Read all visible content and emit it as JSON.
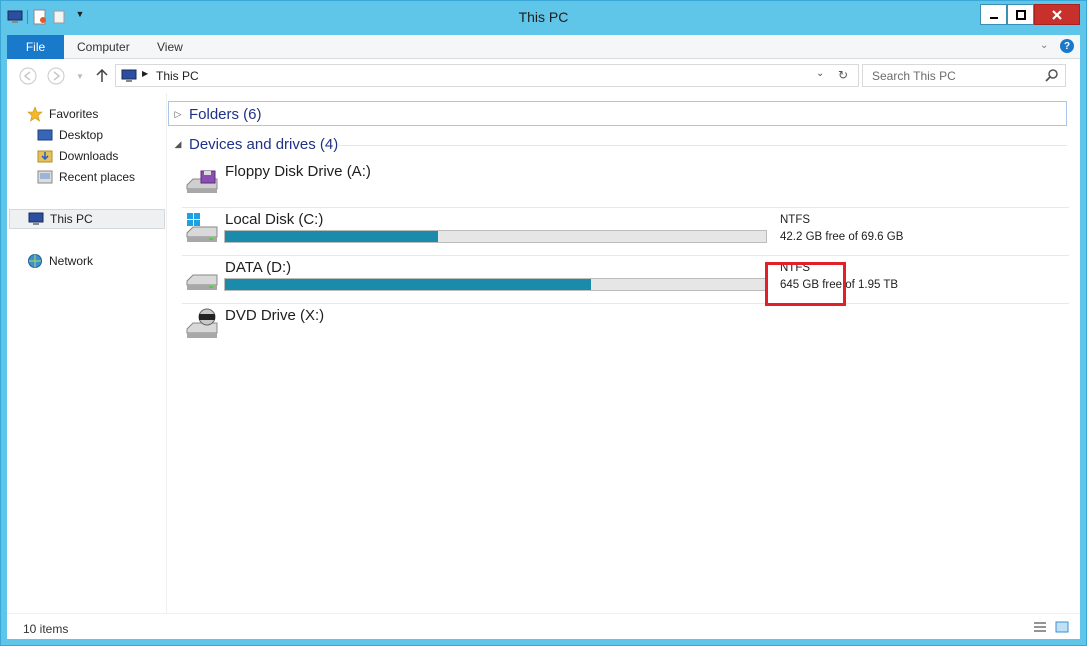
{
  "window": {
    "title": "This PC"
  },
  "ribbon": {
    "tabs": [
      "File",
      "Computer",
      "View"
    ]
  },
  "address": {
    "path": "This PC"
  },
  "search": {
    "placeholder": "Search This PC"
  },
  "sidebar": {
    "items": [
      {
        "label": "Favorites",
        "icon": "star-icon"
      },
      {
        "label": "Desktop",
        "icon": "desktop-icon"
      },
      {
        "label": "Downloads",
        "icon": "downloads-icon"
      },
      {
        "label": "Recent places",
        "icon": "recent-places-icon"
      },
      {
        "label": "This PC",
        "icon": "computer-icon"
      },
      {
        "label": "Network",
        "icon": "network-icon"
      }
    ]
  },
  "groups": {
    "folders": {
      "label": "Folders (6)"
    },
    "devices": {
      "label": "Devices and drives (4)"
    }
  },
  "drives": [
    {
      "name": "Floppy Disk Drive (A:)",
      "fs": "",
      "free": "",
      "used_fraction": null
    },
    {
      "name": "Local Disk (C:)",
      "fs": "NTFS",
      "free": "42.2 GB free of 69.6 GB",
      "used_fraction": 0.394
    },
    {
      "name": "DATA (D:)",
      "fs": "NTFS",
      "free": "645 GB free of 1.95 TB",
      "used_fraction": 0.677
    },
    {
      "name": "DVD Drive (X:)",
      "fs": "",
      "free": "",
      "used_fraction": null
    }
  ],
  "status": {
    "items": "10 items"
  },
  "colors": {
    "accent": "#1979ca",
    "titlebar": "#5fc6ea",
    "bar_fill": "#1a8bab",
    "highlight": "#e2202a"
  }
}
